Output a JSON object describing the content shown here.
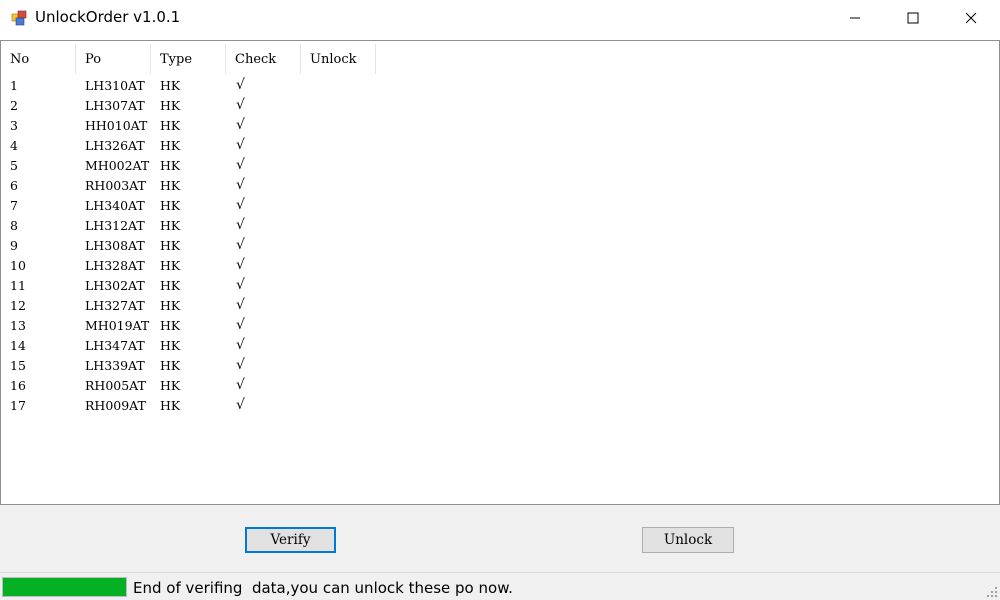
{
  "window": {
    "title": "UnlockOrder v1.0.1",
    "icons": {
      "app": "app-icon",
      "minimize": "minimize-icon",
      "maximize": "maximize-icon",
      "close": "close-icon"
    }
  },
  "list": {
    "columns": [
      "No",
      "Po",
      "Type",
      "Check",
      "Unlock"
    ],
    "rows": [
      {
        "no": "1",
        "po": "LH310AT",
        "type": "HK",
        "check": "√"
      },
      {
        "no": "2",
        "po": "LH307AT",
        "type": "HK",
        "check": "√"
      },
      {
        "no": "3",
        "po": "HH010AT",
        "type": "HK",
        "check": "√"
      },
      {
        "no": "4",
        "po": "LH326AT",
        "type": "HK",
        "check": "√"
      },
      {
        "no": "5",
        "po": "MH002AT",
        "type": "HK",
        "check": "√"
      },
      {
        "no": "6",
        "po": "RH003AT",
        "type": "HK",
        "check": "√"
      },
      {
        "no": "7",
        "po": "LH340AT",
        "type": "HK",
        "check": "√"
      },
      {
        "no": "8",
        "po": "LH312AT",
        "type": "HK",
        "check": "√"
      },
      {
        "no": "9",
        "po": "LH308AT",
        "type": "HK",
        "check": "√"
      },
      {
        "no": "10",
        "po": "LH328AT",
        "type": "HK",
        "check": "√"
      },
      {
        "no": "11",
        "po": "LH302AT",
        "type": "HK",
        "check": "√"
      },
      {
        "no": "12",
        "po": "LH327AT",
        "type": "HK",
        "check": "√"
      },
      {
        "no": "13",
        "po": "MH019AT",
        "type": "HK",
        "check": "√"
      },
      {
        "no": "14",
        "po": "LH347AT",
        "type": "HK",
        "check": "√"
      },
      {
        "no": "15",
        "po": "LH339AT",
        "type": "HK",
        "check": "√"
      },
      {
        "no": "16",
        "po": "RH005AT",
        "type": "HK",
        "check": "√"
      },
      {
        "no": "17",
        "po": "RH009AT",
        "type": "HK",
        "check": "√"
      }
    ]
  },
  "buttons": {
    "verify": "Verify",
    "unlock": "Unlock"
  },
  "status": {
    "text": "End of verifing  data,you can unlock these po now.",
    "progress_percent": 100,
    "progress_color": "#06b025",
    "grip_icon": "resize-grip-icon"
  }
}
